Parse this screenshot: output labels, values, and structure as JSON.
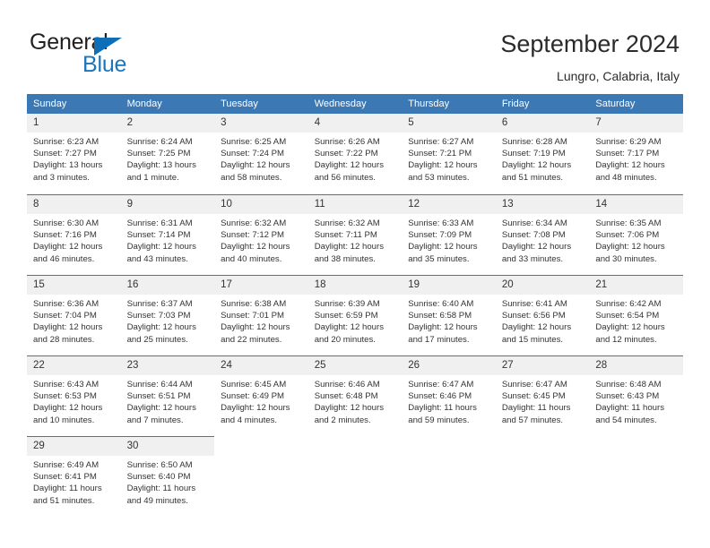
{
  "brand": {
    "name_top": "General",
    "name_bottom": "Blue",
    "triangle_color": "#0d6fb8",
    "text_color": "#231f20",
    "blue_color": "#1b75bb"
  },
  "header": {
    "title": "September 2024",
    "subtitle": "Lungro, Calabria, Italy"
  },
  "theme": {
    "header_bg": "#3c78b4",
    "header_text": "#ffffff",
    "daynum_bg": "#f0f0f0",
    "cell_bg": "#ffffff",
    "body_text": "#333333",
    "rule_color": "#3c78b4"
  },
  "calendar": {
    "weekday_headers": [
      "Sunday",
      "Monday",
      "Tuesday",
      "Wednesday",
      "Thursday",
      "Friday",
      "Saturday"
    ],
    "weeks": [
      [
        {
          "day": "1",
          "sunrise": "Sunrise: 6:23 AM",
          "sunset": "Sunset: 7:27 PM",
          "daylight_1": "Daylight: 13 hours",
          "daylight_2": "and 3 minutes."
        },
        {
          "day": "2",
          "sunrise": "Sunrise: 6:24 AM",
          "sunset": "Sunset: 7:25 PM",
          "daylight_1": "Daylight: 13 hours",
          "daylight_2": "and 1 minute."
        },
        {
          "day": "3",
          "sunrise": "Sunrise: 6:25 AM",
          "sunset": "Sunset: 7:24 PM",
          "daylight_1": "Daylight: 12 hours",
          "daylight_2": "and 58 minutes."
        },
        {
          "day": "4",
          "sunrise": "Sunrise: 6:26 AM",
          "sunset": "Sunset: 7:22 PM",
          "daylight_1": "Daylight: 12 hours",
          "daylight_2": "and 56 minutes."
        },
        {
          "day": "5",
          "sunrise": "Sunrise: 6:27 AM",
          "sunset": "Sunset: 7:21 PM",
          "daylight_1": "Daylight: 12 hours",
          "daylight_2": "and 53 minutes."
        },
        {
          "day": "6",
          "sunrise": "Sunrise: 6:28 AM",
          "sunset": "Sunset: 7:19 PM",
          "daylight_1": "Daylight: 12 hours",
          "daylight_2": "and 51 minutes."
        },
        {
          "day": "7",
          "sunrise": "Sunrise: 6:29 AM",
          "sunset": "Sunset: 7:17 PM",
          "daylight_1": "Daylight: 12 hours",
          "daylight_2": "and 48 minutes."
        }
      ],
      [
        {
          "day": "8",
          "sunrise": "Sunrise: 6:30 AM",
          "sunset": "Sunset: 7:16 PM",
          "daylight_1": "Daylight: 12 hours",
          "daylight_2": "and 46 minutes."
        },
        {
          "day": "9",
          "sunrise": "Sunrise: 6:31 AM",
          "sunset": "Sunset: 7:14 PM",
          "daylight_1": "Daylight: 12 hours",
          "daylight_2": "and 43 minutes."
        },
        {
          "day": "10",
          "sunrise": "Sunrise: 6:32 AM",
          "sunset": "Sunset: 7:12 PM",
          "daylight_1": "Daylight: 12 hours",
          "daylight_2": "and 40 minutes."
        },
        {
          "day": "11",
          "sunrise": "Sunrise: 6:32 AM",
          "sunset": "Sunset: 7:11 PM",
          "daylight_1": "Daylight: 12 hours",
          "daylight_2": "and 38 minutes."
        },
        {
          "day": "12",
          "sunrise": "Sunrise: 6:33 AM",
          "sunset": "Sunset: 7:09 PM",
          "daylight_1": "Daylight: 12 hours",
          "daylight_2": "and 35 minutes."
        },
        {
          "day": "13",
          "sunrise": "Sunrise: 6:34 AM",
          "sunset": "Sunset: 7:08 PM",
          "daylight_1": "Daylight: 12 hours",
          "daylight_2": "and 33 minutes."
        },
        {
          "day": "14",
          "sunrise": "Sunrise: 6:35 AM",
          "sunset": "Sunset: 7:06 PM",
          "daylight_1": "Daylight: 12 hours",
          "daylight_2": "and 30 minutes."
        }
      ],
      [
        {
          "day": "15",
          "sunrise": "Sunrise: 6:36 AM",
          "sunset": "Sunset: 7:04 PM",
          "daylight_1": "Daylight: 12 hours",
          "daylight_2": "and 28 minutes."
        },
        {
          "day": "16",
          "sunrise": "Sunrise: 6:37 AM",
          "sunset": "Sunset: 7:03 PM",
          "daylight_1": "Daylight: 12 hours",
          "daylight_2": "and 25 minutes."
        },
        {
          "day": "17",
          "sunrise": "Sunrise: 6:38 AM",
          "sunset": "Sunset: 7:01 PM",
          "daylight_1": "Daylight: 12 hours",
          "daylight_2": "and 22 minutes."
        },
        {
          "day": "18",
          "sunrise": "Sunrise: 6:39 AM",
          "sunset": "Sunset: 6:59 PM",
          "daylight_1": "Daylight: 12 hours",
          "daylight_2": "and 20 minutes."
        },
        {
          "day": "19",
          "sunrise": "Sunrise: 6:40 AM",
          "sunset": "Sunset: 6:58 PM",
          "daylight_1": "Daylight: 12 hours",
          "daylight_2": "and 17 minutes."
        },
        {
          "day": "20",
          "sunrise": "Sunrise: 6:41 AM",
          "sunset": "Sunset: 6:56 PM",
          "daylight_1": "Daylight: 12 hours",
          "daylight_2": "and 15 minutes."
        },
        {
          "day": "21",
          "sunrise": "Sunrise: 6:42 AM",
          "sunset": "Sunset: 6:54 PM",
          "daylight_1": "Daylight: 12 hours",
          "daylight_2": "and 12 minutes."
        }
      ],
      [
        {
          "day": "22",
          "sunrise": "Sunrise: 6:43 AM",
          "sunset": "Sunset: 6:53 PM",
          "daylight_1": "Daylight: 12 hours",
          "daylight_2": "and 10 minutes."
        },
        {
          "day": "23",
          "sunrise": "Sunrise: 6:44 AM",
          "sunset": "Sunset: 6:51 PM",
          "daylight_1": "Daylight: 12 hours",
          "daylight_2": "and 7 minutes."
        },
        {
          "day": "24",
          "sunrise": "Sunrise: 6:45 AM",
          "sunset": "Sunset: 6:49 PM",
          "daylight_1": "Daylight: 12 hours",
          "daylight_2": "and 4 minutes."
        },
        {
          "day": "25",
          "sunrise": "Sunrise: 6:46 AM",
          "sunset": "Sunset: 6:48 PM",
          "daylight_1": "Daylight: 12 hours",
          "daylight_2": "and 2 minutes."
        },
        {
          "day": "26",
          "sunrise": "Sunrise: 6:47 AM",
          "sunset": "Sunset: 6:46 PM",
          "daylight_1": "Daylight: 11 hours",
          "daylight_2": "and 59 minutes."
        },
        {
          "day": "27",
          "sunrise": "Sunrise: 6:47 AM",
          "sunset": "Sunset: 6:45 PM",
          "daylight_1": "Daylight: 11 hours",
          "daylight_2": "and 57 minutes."
        },
        {
          "day": "28",
          "sunrise": "Sunrise: 6:48 AM",
          "sunset": "Sunset: 6:43 PM",
          "daylight_1": "Daylight: 11 hours",
          "daylight_2": "and 54 minutes."
        }
      ],
      [
        {
          "day": "29",
          "sunrise": "Sunrise: 6:49 AM",
          "sunset": "Sunset: 6:41 PM",
          "daylight_1": "Daylight: 11 hours",
          "daylight_2": "and 51 minutes."
        },
        {
          "day": "30",
          "sunrise": "Sunrise: 6:50 AM",
          "sunset": "Sunset: 6:40 PM",
          "daylight_1": "Daylight: 11 hours",
          "daylight_2": "and 49 minutes."
        },
        {
          "day": "",
          "sunrise": "",
          "sunset": "",
          "daylight_1": "",
          "daylight_2": ""
        },
        {
          "day": "",
          "sunrise": "",
          "sunset": "",
          "daylight_1": "",
          "daylight_2": ""
        },
        {
          "day": "",
          "sunrise": "",
          "sunset": "",
          "daylight_1": "",
          "daylight_2": ""
        },
        {
          "day": "",
          "sunrise": "",
          "sunset": "",
          "daylight_1": "",
          "daylight_2": ""
        },
        {
          "day": "",
          "sunrise": "",
          "sunset": "",
          "daylight_1": "",
          "daylight_2": ""
        }
      ]
    ]
  }
}
